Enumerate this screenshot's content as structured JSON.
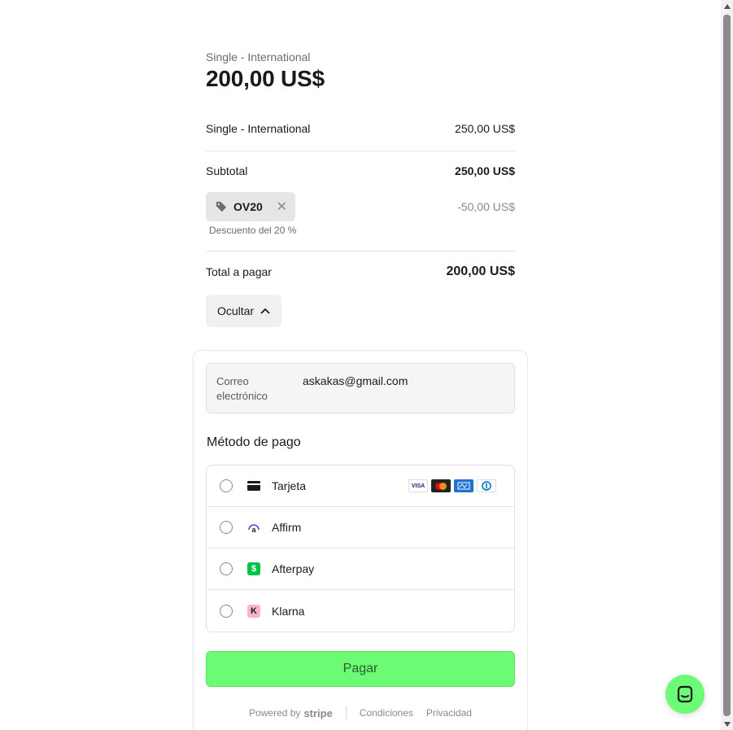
{
  "summary": {
    "product_name": "Single - International",
    "total_big": "200,00 US$"
  },
  "line_item": {
    "name": "Single - International",
    "amount": "250,00 US$"
  },
  "subtotal": {
    "label": "Subtotal",
    "amount": "250,00 US$"
  },
  "coupon": {
    "code": "OV20",
    "amount": "-50,00 US$",
    "note": "Descuento del 20 %"
  },
  "total": {
    "label": "Total a pagar",
    "amount": "200,00 US$"
  },
  "toggle": {
    "label": "Ocultar"
  },
  "email": {
    "label": "Correo electrónico",
    "value": "askakas@gmail.com"
  },
  "payment": {
    "title": "Método de pago",
    "methods": [
      {
        "label": "Tarjeta",
        "icon": "card-icon"
      },
      {
        "label": "Affirm",
        "icon": "affirm-icon"
      },
      {
        "label": "Afterpay",
        "icon": "afterpay-icon"
      },
      {
        "label": "Klarna",
        "icon": "klarna-icon"
      }
    ],
    "card_brands": [
      "VISA",
      "mastercard",
      "amex",
      "diners"
    ]
  },
  "pay_button": {
    "label": "Pagar",
    "color": "#6cfb75"
  },
  "footer": {
    "powered_by": "Powered by",
    "brand": "stripe",
    "terms": "Condiciones",
    "privacy": "Privacidad"
  }
}
